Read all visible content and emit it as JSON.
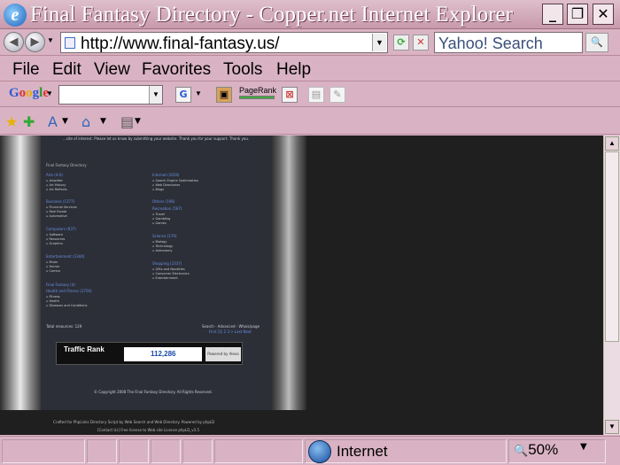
{
  "window": {
    "title": "Final Fantasy Directory - Copper.net Internet Explorer"
  },
  "address": {
    "url": "http://www.final-fantasy.us/",
    "search_placeholder": "Yahoo! Search"
  },
  "menu": [
    "File",
    "Edit",
    "View",
    "Favorites",
    "Tools",
    "Help"
  ],
  "google_toolbar": {
    "brand": "Google",
    "pagerank_label": "PageRank"
  },
  "page": {
    "intro": "...site of interest. Please let us know by submitting your website. Thank you for your support. Thank you.",
    "dir_title": "Final Fantasy Directory",
    "left_categories": [
      {
        "name": "Arts (4-6)",
        "subs": [
          "Artwriter",
          "Art History",
          "Art Reflects"
        ]
      },
      {
        "name": "Business (1377)",
        "subs": [
          "Financial Services",
          "Real Estate",
          "Automotive"
        ]
      },
      {
        "name": "Computers (937)",
        "subs": [
          "Software",
          "Resources",
          "Graphics"
        ]
      },
      {
        "name": "Entertainment (1344)",
        "subs": [
          "Music",
          "Humor",
          "Comics"
        ]
      },
      {
        "name": "Final Fantasy (4)",
        "subs": []
      },
      {
        "name": "Health and Fitness (1756)",
        "subs": [
          "Fitness",
          "Health",
          "Diseases and Conditions"
        ]
      }
    ],
    "right_categories": [
      {
        "name": "Internet (1659)",
        "subs": [
          "Search Engine Optimization",
          "Web Directories",
          "Blogs"
        ]
      },
      {
        "name": "Others (196)",
        "subs": []
      },
      {
        "name": "Recreation (567)",
        "subs": [
          "Travel",
          "Gambling",
          "Games"
        ]
      },
      {
        "name": "Science (179)",
        "subs": [
          "Biology",
          "Technology",
          "Astronomy"
        ]
      },
      {
        "name": "Shopping (2337)",
        "subs": [
          "Gifts and Novelties",
          "Consumer Electronics",
          "Entertainment"
        ]
      }
    ],
    "total_line": "Total resources: 129",
    "powered": "Search - Advanced - Whois/page",
    "pager": "First [1] 2 3 > Last Next",
    "traffic_label": "Traffic Rank",
    "traffic_value": "112,286",
    "alexa": "Powered by Alexa",
    "copyright": "© Copyright 2008 The Final Fantasy Directory. All Rights Reserved.",
    "credits": "Crafted for PhpLinks Directory Script by Web Search and Web Directory. Powered by phpLD",
    "credits2": "[Contact Us] Free license to Web site License phpLD_v3.5"
  },
  "status": {
    "zone": "Internet",
    "zoom": "50%"
  }
}
